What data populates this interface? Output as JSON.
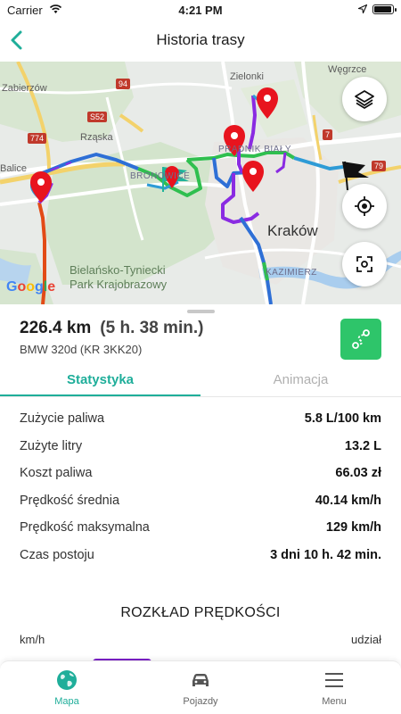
{
  "status_bar": {
    "carrier": "Carrier",
    "time": "4:21 PM",
    "battery_level": 0.95
  },
  "nav": {
    "title": "Historia trasy",
    "back_icon": "chevron-left-icon"
  },
  "map": {
    "labels": {
      "zabierzow": "Zabierzów",
      "rzaska": "Rząska",
      "balice": "Balice",
      "zielonki": "Zielonki",
      "wegrzce": "Węgrzce",
      "pradnik": "PRĄDNIK BIAŁY",
      "bronowice": "BRONOWICE",
      "krakow": "Kraków",
      "kazimierz": "KAZIMIERZ",
      "park_line1": "Bielańsko-Tyniecki",
      "park_line2": "Park Krajobrazowy"
    },
    "road_badges": {
      "r94": "94",
      "s52": "S52",
      "r774": "774",
      "r7": "7",
      "r79": "79"
    },
    "google": {
      "g1": "G",
      "o1": "o",
      "o2": "o",
      "g2": "g",
      "l": "l",
      "e": "e"
    },
    "buttons": {
      "layers": "layers-icon",
      "locate": "crosshair-icon",
      "fit": "fit-route-icon"
    },
    "colors": {
      "route_fast": "#8a2be2",
      "route_mid": "#2e9bd6",
      "route_slow": "#2fbf4f",
      "marker": "#e8141e",
      "start_flag": "#20b39a",
      "end_flag": "#111111"
    }
  },
  "trip": {
    "distance": "226.4 km",
    "duration": "(5 h. 38 min.)",
    "vehicle": "BMW 320d (KR 3KK20)",
    "route_icon": "route-icon"
  },
  "tabs": [
    {
      "label": "Statystyka",
      "active": true
    },
    {
      "label": "Animacja",
      "active": false
    }
  ],
  "stats": [
    {
      "label": "Zużycie paliwa",
      "value": "5.8 L/100 km"
    },
    {
      "label": "Zużyte litry",
      "value": "13.2 L"
    },
    {
      "label": "Koszt paliwa",
      "value": "66.03 zł"
    },
    {
      "label": "Prędkość średnia",
      "value": "40.14 km/h"
    },
    {
      "label": "Prędkość maksymalna",
      "value": "129 km/h"
    },
    {
      "label": "Czas postoju",
      "value": "3 dni 10 h. 42 min."
    }
  ],
  "speed_distribution": {
    "title": "ROZKŁAD PRĘDKOŚCI",
    "unit_label": "km/h",
    "share_label": "udział",
    "first_bar_color": "#7b1fc8"
  },
  "bottom_tabs": [
    {
      "label": "Mapa",
      "icon": "globe-icon",
      "active": true
    },
    {
      "label": "Pojazdy",
      "icon": "car-icon",
      "active": false
    },
    {
      "label": "Menu",
      "icon": "hamburger-icon",
      "active": false
    }
  ],
  "accent_color": "#1fae9a"
}
